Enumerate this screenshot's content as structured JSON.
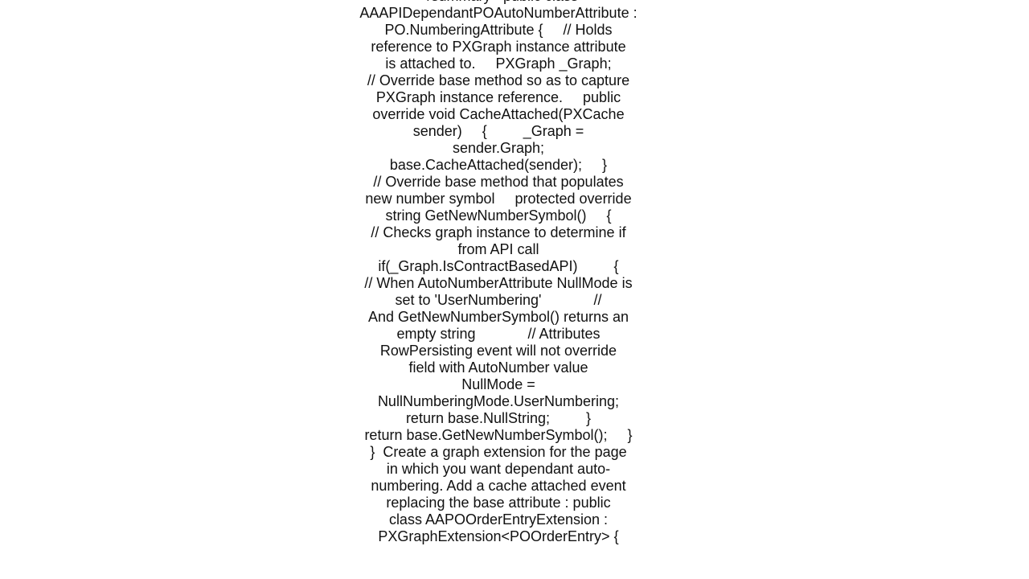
{
  "document": {
    "lines": [
      "</summary> public class",
      "AAAPIDependantPOAutoNumberAttribute :",
      "PO.NumberingAttribute {     // Holds",
      "reference to PXGraph instance attribute",
      "is attached to.     PXGraph _Graph;",
      "// Override base method so as to capture",
      "PXGraph instance reference.     public",
      "override void CacheAttached(PXCache",
      "sender)     {         _Graph =",
      "sender.Graph;",
      "base.CacheAttached(sender);     }",
      "// Override base method that populates",
      "new number symbol     protected override",
      "string GetNewNumberSymbol()     {",
      "// Checks graph instance to determine if",
      "from API call",
      "if(_Graph.IsContractBasedAPI)         {",
      "// When AutoNumberAttribute NullMode is",
      "set to 'UserNumbering'             //",
      "And GetNewNumberSymbol() returns an",
      "empty string             // Attributes",
      "RowPersisting event will not override",
      "field with AutoNumber value",
      "NullMode =",
      "NullNumberingMode.UserNumbering;",
      "return base.NullString;         }",
      "return base.GetNewNumberSymbol();     }",
      "}  Create a graph extension for the page",
      "in which you want dependant auto-",
      "numbering. Add a cache attached event",
      "replacing the base attribute : public",
      "class AAPOOrderEntryExtension :",
      "PXGraphExtension<POOrderEntry> {"
    ]
  }
}
